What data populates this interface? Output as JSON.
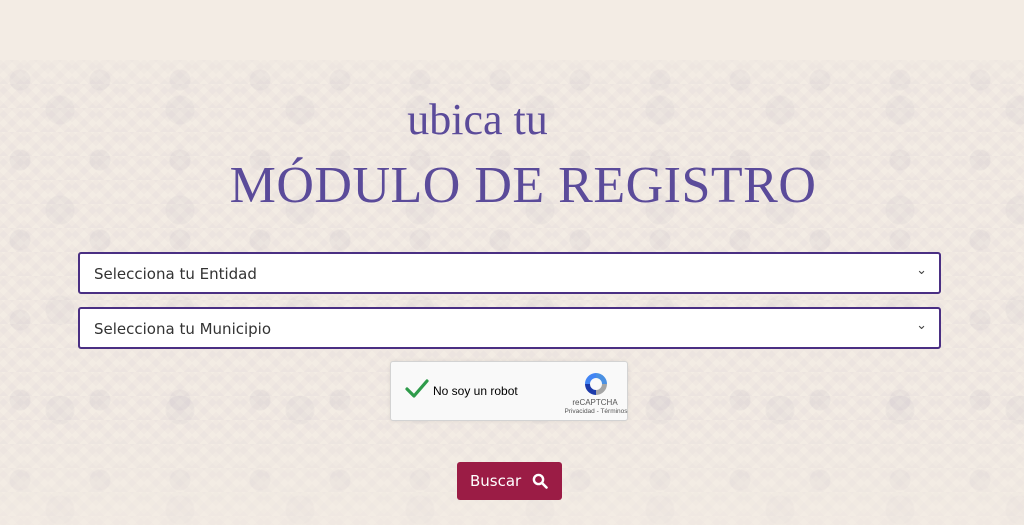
{
  "header": {
    "line1": "ubica tu",
    "line2": "MÓDULO DE REGISTRO"
  },
  "form": {
    "entidad_select": {
      "selected": "Selecciona tu Entidad"
    },
    "municipio_select": {
      "selected": "Selecciona tu Municipio"
    },
    "recaptcha": {
      "label": "No soy un robot",
      "brand": "reCAPTCHA",
      "links": "Privacidad - Términos",
      "checked": true
    },
    "submit": {
      "label": "Buscar",
      "icon": "search-icon"
    }
  },
  "colors": {
    "heading": "#5b4b9a",
    "select_border": "#4a2f83",
    "button_bg": "#9b1c45",
    "check_green": "#2e9b4a",
    "background": "#f3ece4"
  }
}
